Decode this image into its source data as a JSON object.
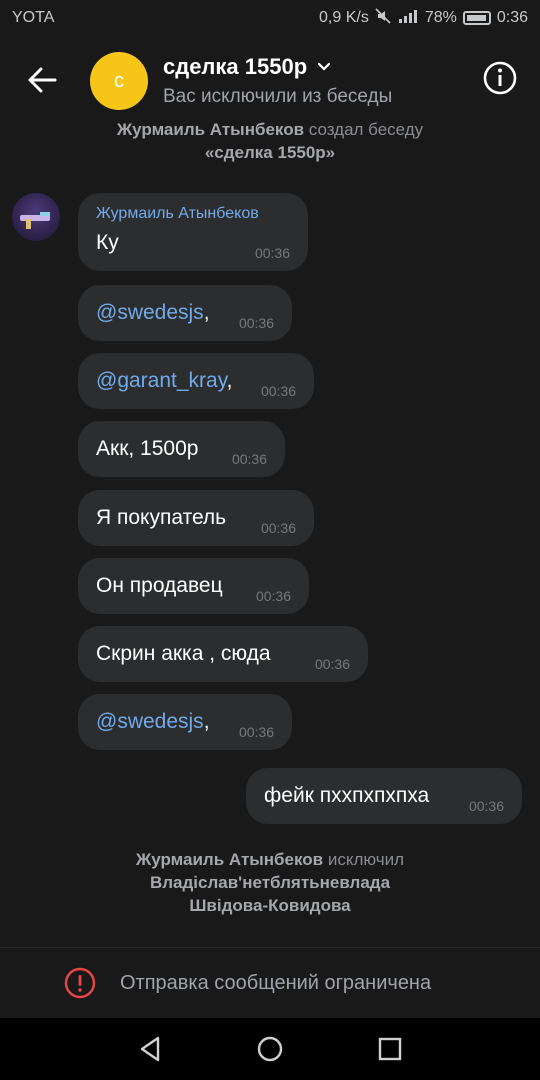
{
  "status_bar": {
    "carrier": "YOTA",
    "speed": "0,9 K/s",
    "battery": "78%",
    "time": "0:36"
  },
  "header": {
    "avatar_letter": "с",
    "title": "сделка 1550р",
    "subtitle": "Вас исключили из беседы"
  },
  "created_notice": {
    "actor": "Журмаиль Атынбеков",
    "action": "создал беседу",
    "chat_name": "«сделка 1550р»"
  },
  "messages": [
    {
      "sender": "Журмаиль Атынбеков",
      "text": "Ку",
      "time": "00:36"
    },
    {
      "text": "@swedesjs",
      "suffix": ",",
      "time": "00:36"
    },
    {
      "text": "@garant_kray",
      "suffix": ",",
      "time": "00:36"
    },
    {
      "text": "Акк, 1500р",
      "time": "00:36"
    },
    {
      "text": "Я покупатель",
      "time": "00:36"
    },
    {
      "text": "Он продавец",
      "time": "00:36"
    },
    {
      "text": "Скрин акка , сюда",
      "time": "00:36"
    },
    {
      "text": "@swedesjs",
      "suffix": ",",
      "time": "00:36"
    },
    {
      "text": "фейк пххпхпхпха",
      "time": "00:36",
      "outgoing": true
    }
  ],
  "excluded_notice": {
    "actor": "Журмаиль Атынбеков",
    "action": "исключил",
    "target_line1": "Владіслав'нетблятьневлада",
    "target_line2": "Швідова-Ковидова"
  },
  "composer": {
    "notice": "Отправка сообщений ограничена"
  },
  "colors": {
    "accent": "#71aaeb",
    "avatar_yellow": "#f5c518",
    "warning_red": "#e64646"
  }
}
